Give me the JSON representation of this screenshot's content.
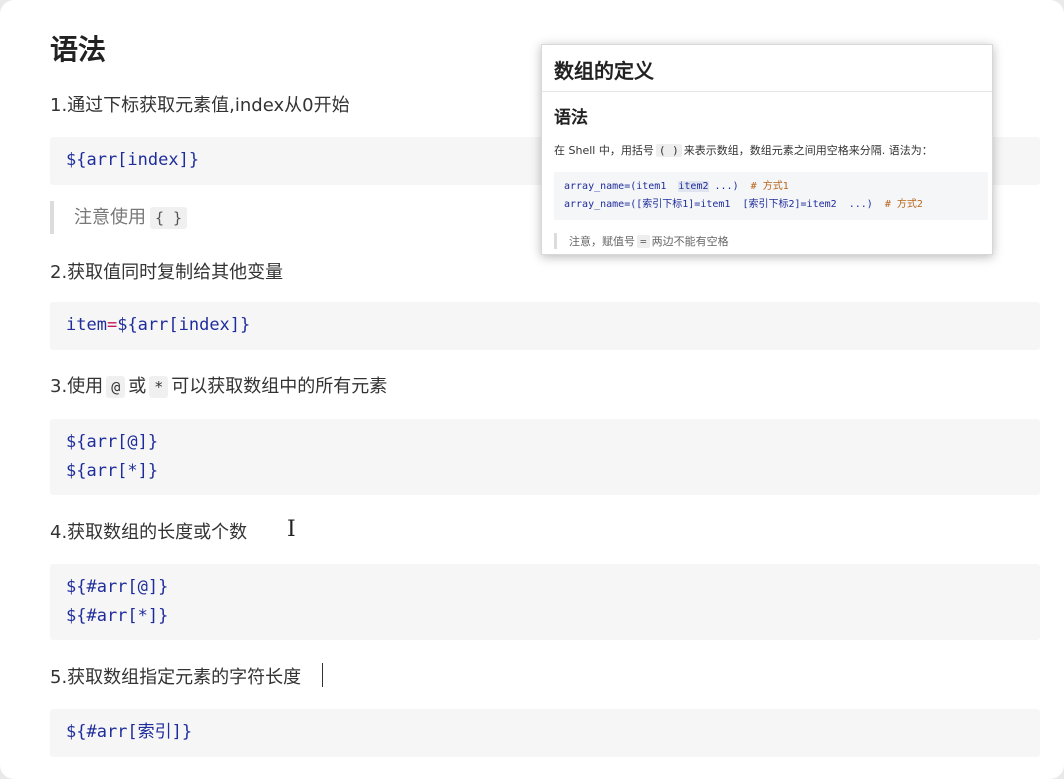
{
  "heading": "语法",
  "items": [
    {
      "label": "1.通过下标获取元素值,index从0开始",
      "code": [
        "${arr[index]}"
      ]
    },
    {
      "label": "2.获取值同时复制给其他变量",
      "code": [
        "item=${arr[index]}"
      ]
    },
    {
      "label_pre": "3.使用",
      "label_code1": "@",
      "label_mid": "或",
      "label_code2": "*",
      "label_post": "可以获取数组中的所有元素",
      "code": [
        "${arr[@]}",
        "${arr[*]}"
      ]
    },
    {
      "label": "4.获取数组的长度或个数",
      "code": [
        "${#arr[@]}",
        "${#arr[*]}"
      ]
    },
    {
      "label": "5.获取数组指定元素的字符长度",
      "code": [
        "${#arr[索引]}"
      ]
    }
  ],
  "note": {
    "text": "注意使用",
    "code": "{ }"
  },
  "popup": {
    "title": "数组的定义",
    "subtitle": "语法",
    "text_pre": "在 Shell 中，用括号",
    "text_code": "( )",
    "text_post": "来表示数组，数组元素之间用空格来分隔. 语法为：",
    "code1_main": "array_name=(item1  ",
    "code1_hl": "item2",
    "code1_rest": " ...)  ",
    "code1_comment": "# 方式1",
    "code2_main": "array_name=([索引下标1]=item1  [索引下标2]=item2  ...)  ",
    "code2_comment": "# 方式2",
    "quote_pre": "注意，赋值号",
    "quote_code": "=",
    "quote_post": "两边不能有空格"
  }
}
